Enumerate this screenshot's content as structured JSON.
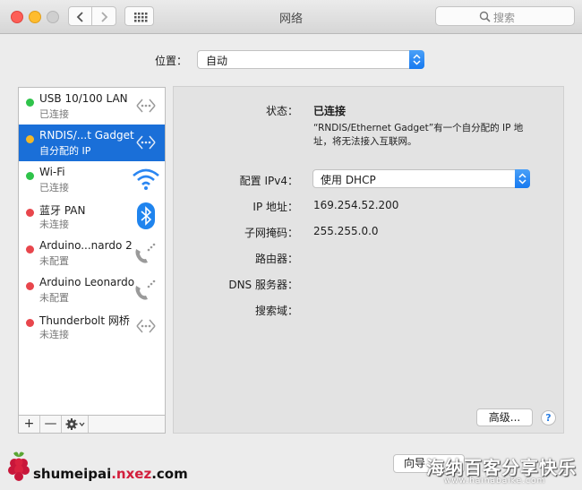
{
  "window": {
    "title": "网络"
  },
  "toolbar": {
    "search_placeholder": "搜索"
  },
  "location": {
    "label": "位置：",
    "value": "自动"
  },
  "services": [
    {
      "name": "USB 10/100 LAN",
      "status": "已连接",
      "dot_color": "#2fc34a",
      "icon": "ethernet-arrows-icon",
      "selected": false
    },
    {
      "name": "RNDIS/...t Gadget",
      "status": "自分配的 IP",
      "dot_color": "#f3b828",
      "icon": "ethernet-arrows-icon",
      "selected": true
    },
    {
      "name": "Wi-Fi",
      "status": "已连接",
      "dot_color": "#2fc34a",
      "icon": "wifi-icon",
      "selected": false
    },
    {
      "name": "蓝牙 PAN",
      "status": "未连接",
      "dot_color": "#e8464c",
      "icon": "bluetooth-icon",
      "selected": false
    },
    {
      "name": "Arduino...nardo 2",
      "status": "未配置",
      "dot_color": "#e8464c",
      "icon": "phone-modem-icon",
      "selected": false
    },
    {
      "name": "Arduino Leonardo",
      "status": "未配置",
      "dot_color": "#e8464c",
      "icon": "phone-modem-icon",
      "selected": false
    },
    {
      "name": "Thunderbolt 网桥",
      "status": "未连接",
      "dot_color": "#e8464c",
      "icon": "ethernet-arrows-icon",
      "selected": false
    }
  ],
  "sidebar_footer": {
    "add": "+",
    "remove": "—"
  },
  "detail": {
    "status_label": "状态：",
    "status_value": "已连接",
    "status_description": "“RNDIS/Ethernet Gadget”有一个自分配的 IP 地址，将无法接入互联网。",
    "configure_label": "配置 IPv4：",
    "configure_value": "使用 DHCP",
    "ip_label": "IP 地址：",
    "ip_value": "169.254.52.200",
    "subnet_label": "子网掩码：",
    "subnet_value": "255.255.0.0",
    "router_label": "路由器：",
    "dns_label": "DNS 服务器：",
    "search_domain_label": "搜索域：",
    "advanced_button": "高级...",
    "help_button": "?"
  },
  "bottom": {
    "wizard_button": "向导"
  },
  "watermark": {
    "logo_text_main": "shumeipai",
    "logo_text_accent": ".nxez",
    "logo_text_tail": ".com",
    "cn_text": "海纳百客分享快乐",
    "url_text": "www.hainabaike.com"
  },
  "colors": {
    "selection": "#1a6fd8",
    "accent": "#1679f0"
  }
}
